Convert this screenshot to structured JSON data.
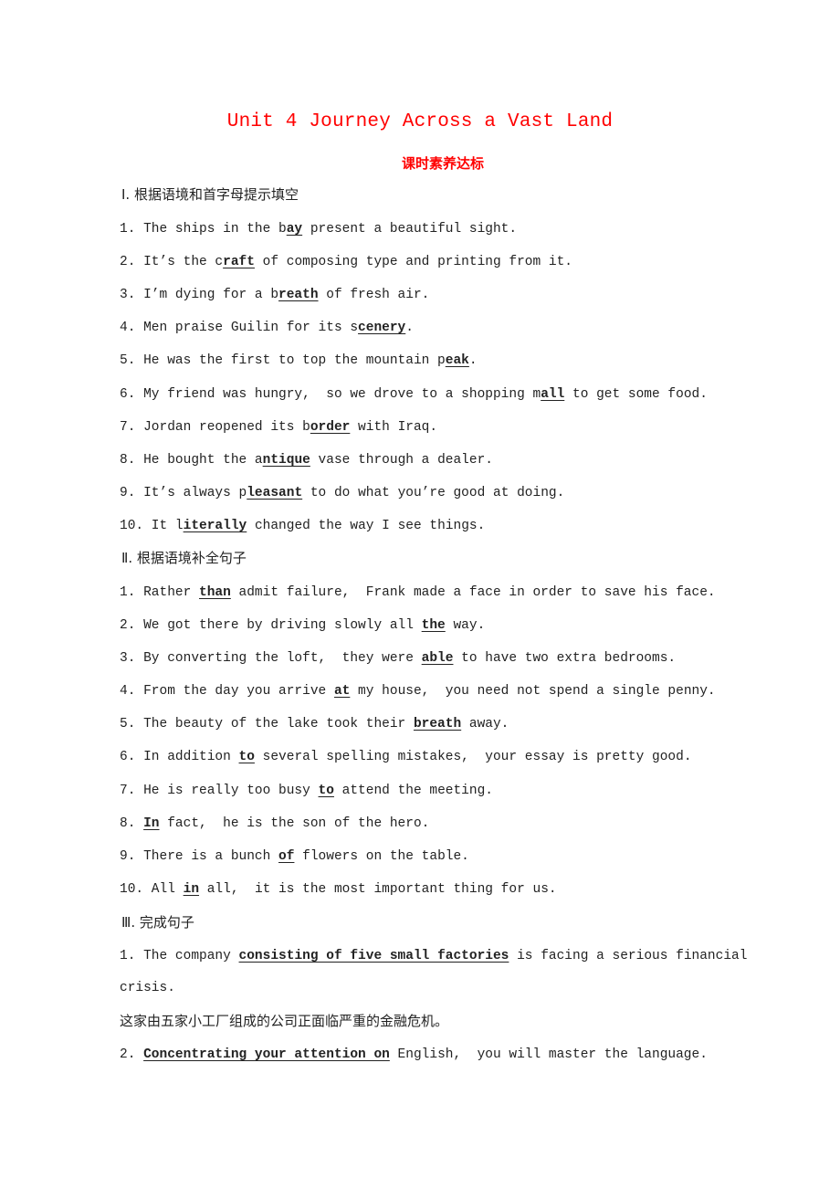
{
  "title": "Unit 4 Journey Across a Vast Land",
  "subtitle": "课时素养达标",
  "sections": [
    {
      "heading": "Ⅰ. 根据语境和首字母提示填空",
      "items": [
        {
          "pre": "1. The ships in the b",
          "ans": "ay",
          "post": " present a beautiful sight."
        },
        {
          "pre": "2. It’s the c",
          "ans": "raft",
          "post": " of composing type and printing from it."
        },
        {
          "pre": "3. I’m dying for a b",
          "ans": "reath",
          "post": " of fresh air."
        },
        {
          "pre": "4. Men praise Guilin for its s",
          "ans": "cenery",
          "post": "."
        },
        {
          "pre": "5. He was the first to top the mountain p",
          "ans": "eak",
          "post": "."
        },
        {
          "pre": "6. My friend was hungry,  so we drove to a shopping m",
          "ans": "all",
          "post": " to get some food."
        },
        {
          "pre": "7. Jordan reopened its b",
          "ans": "order",
          "post": " with Iraq."
        },
        {
          "pre": "8. He bought the a",
          "ans": "ntique",
          "post": " vase through a dealer."
        },
        {
          "pre": "9. It’s always p",
          "ans": "leasant",
          "post": " to do what you’re good at doing."
        },
        {
          "pre": "10. It l",
          "ans": "iterally",
          "post": " changed the way I see things."
        }
      ]
    },
    {
      "heading": "Ⅱ. 根据语境补全句子",
      "items": [
        {
          "pre": "1. Rather ",
          "ans": "than",
          "post": " admit failure,  Frank made a face in order to save his face."
        },
        {
          "pre": "2. We got there by driving slowly all ",
          "ans": "the",
          "post": " way."
        },
        {
          "pre": "3. By converting the loft,  they were ",
          "ans": "able",
          "post": " to have two extra bedrooms."
        },
        {
          "pre": "4. From the day you arrive ",
          "ans": "at",
          "post": " my house,  you need not spend a single penny."
        },
        {
          "pre": "5. The beauty of the lake took their ",
          "ans": "breath",
          "post": " away."
        },
        {
          "pre": "6. In addition ",
          "ans": "to",
          "post": " several spelling mistakes,  your essay is pretty good."
        },
        {
          "pre": "7. He is really too busy ",
          "ans": "to",
          "post": " attend the meeting."
        },
        {
          "pre": "8. ",
          "ans": "In",
          "post": " fact,  he is the son of the hero."
        },
        {
          "pre": "9. There is a bunch ",
          "ans": "of",
          "post": " flowers on the table."
        },
        {
          "pre": "10. All ",
          "ans": "in",
          "post": " all,  it is the most important thing for us."
        }
      ]
    },
    {
      "heading": "Ⅲ. 完成句子",
      "items": [
        {
          "pre": "1. The company ",
          "ans": "consisting of five small factories",
          "post": " is facing a serious financial"
        },
        {
          "pre": "crisis.",
          "ans": "",
          "post": ""
        },
        {
          "cn": "这家由五家小工厂组成的公司正面临严重的金融危机。"
        },
        {
          "pre": "2. ",
          "ans": "Concentrating your attention on",
          "post": " English,  you will master the language."
        }
      ]
    }
  ]
}
